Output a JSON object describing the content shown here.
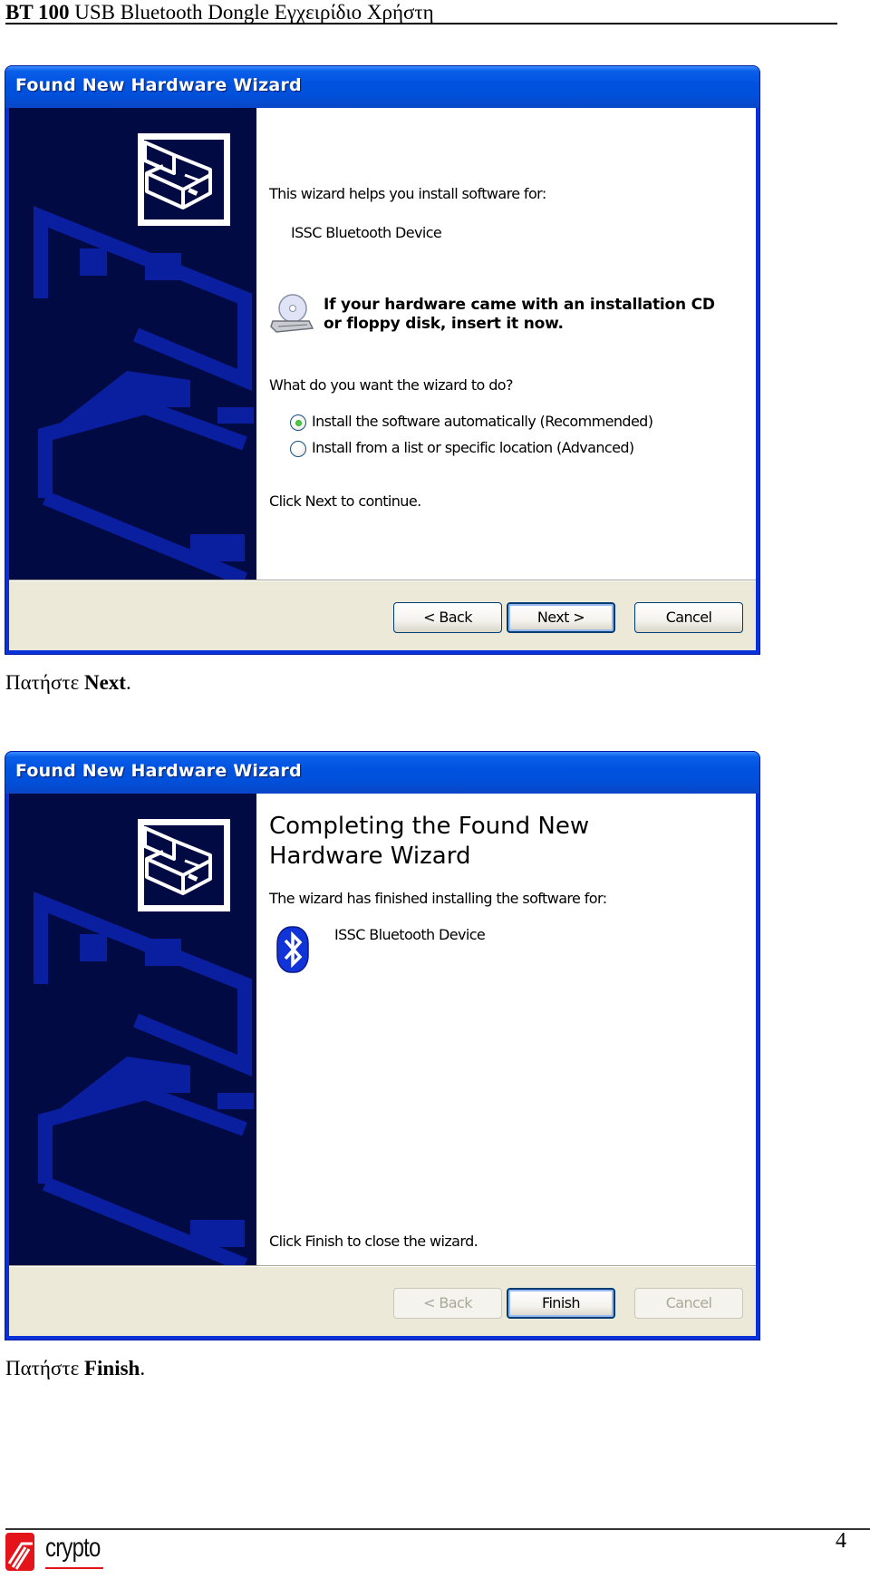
{
  "document": {
    "header_bold": "BT 100",
    "header_rest": " USB Bluetooth Dongle Εγχειρίδιο Χρήστη",
    "page_number": "4",
    "logo_text": "crypto"
  },
  "wizard1": {
    "title": "Found New Hardware Wizard",
    "intro": "This wizard helps you install software for:",
    "device": "ISSC Bluetooth Device",
    "cd_note_line1": "If your hardware came with an installation CD",
    "cd_note_line2": "or floppy disk, insert it now.",
    "question": "What do you want the wizard to do?",
    "options": [
      {
        "label": "Install the software automatically (Recommended)",
        "selected": true
      },
      {
        "label": "Install from a list or specific location (Advanced)",
        "selected": false
      }
    ],
    "footer_text": "Click Next to continue.",
    "buttons": {
      "back": "< Back",
      "next": "Next >",
      "cancel": "Cancel"
    }
  },
  "caption1": {
    "prefix": "Πατήστε ",
    "bold": "Next",
    "suffix": "."
  },
  "wizard2": {
    "title": "Found New Hardware Wizard",
    "heading_line1": "Completing the Found New",
    "heading_line2": "Hardware Wizard",
    "intro": "The wizard has finished installing the software for:",
    "device": "ISSC Bluetooth Device",
    "footer_text": "Click Finish to close the wizard.",
    "buttons": {
      "back": "< Back",
      "finish": "Finish",
      "cancel": "Cancel"
    }
  },
  "caption2": {
    "prefix": "Πατήστε ",
    "bold": "Finish",
    "suffix": "."
  },
  "colors": {
    "titlebar": "#0053e0",
    "banner_bg": "#020a44",
    "banner_shape": "#0a1fa0",
    "dialog_face": "#ece9d8",
    "logo_red": "#e4141b"
  }
}
